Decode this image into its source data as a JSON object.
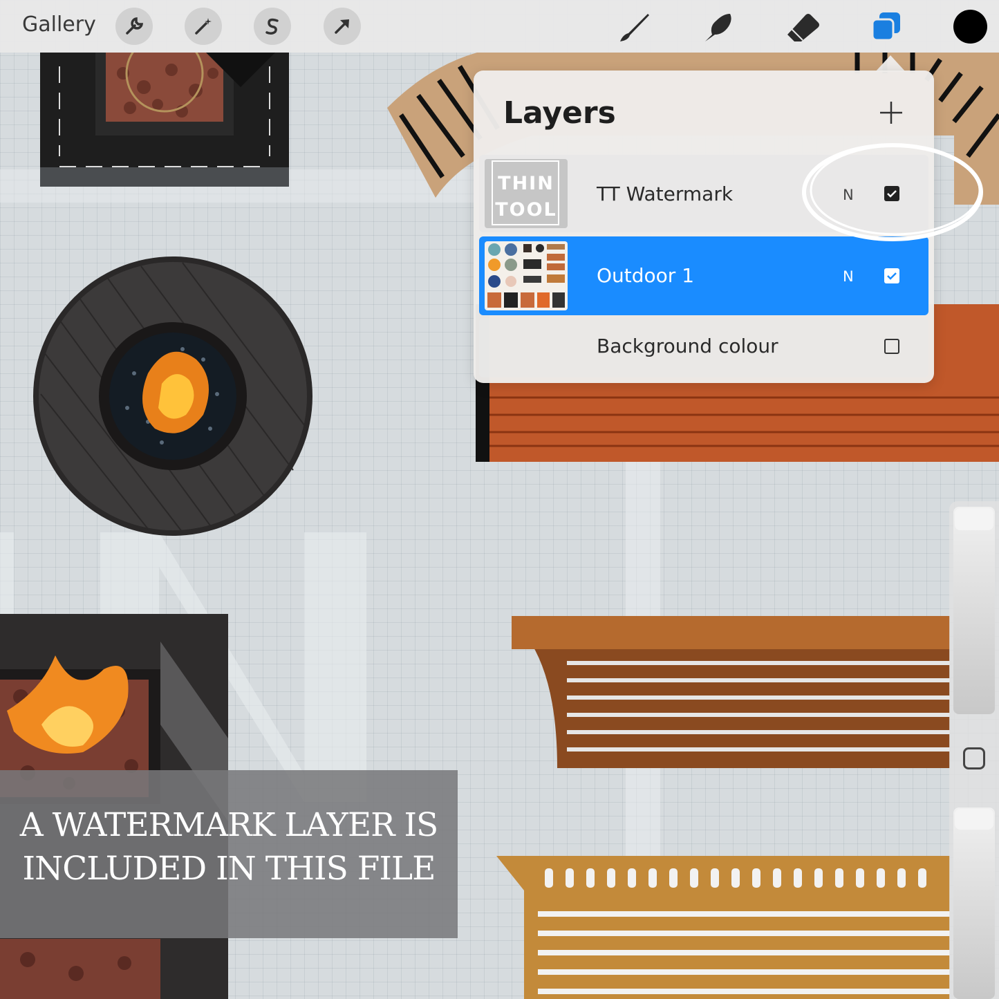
{
  "toolbar": {
    "gallery_label": "Gallery",
    "left_tools": [
      "wrench-icon",
      "magic-wand-icon",
      "selection-s-icon",
      "transform-arrow-icon"
    ],
    "right_tools": [
      "brush-icon",
      "smudge-icon",
      "eraser-icon",
      "layers-icon"
    ],
    "current_color": "#000000",
    "layers_accent": "#1a7fe0"
  },
  "layers_panel": {
    "title": "Layers",
    "add_label": "+",
    "layers": [
      {
        "name": "TT Watermark",
        "blend_mode": "N",
        "visible": true,
        "selected": false,
        "thumb_text_1": "THIN",
        "thumb_text_2": "TOOL"
      },
      {
        "name": "Outdoor 1",
        "blend_mode": "N",
        "visible": true,
        "selected": true
      },
      {
        "name": "Background colour",
        "visible": false
      }
    ],
    "selected_color": "#1a8cff"
  },
  "caption": {
    "line1": "A WATERMARK LAYER IS",
    "line2": "INCLUDED IN THIS FILE"
  }
}
